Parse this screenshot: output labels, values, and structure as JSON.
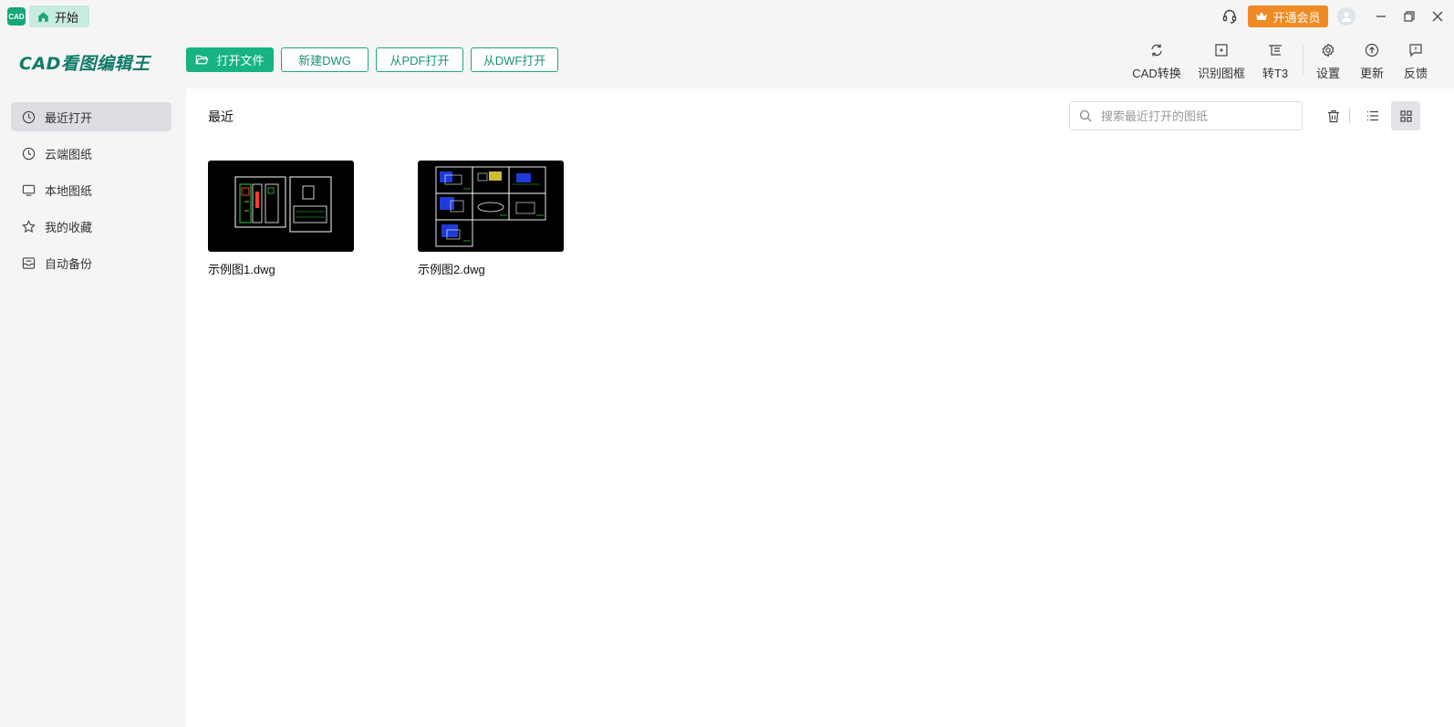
{
  "titlebar": {
    "app_badge": "CAD",
    "home_tab": "开始",
    "vip_button": "开通会员",
    "icons": [
      "headset-icon",
      "crown-icon",
      "avatar-icon",
      "minimize-icon",
      "restore-icon",
      "close-icon"
    ]
  },
  "logo": "CAD看图编辑王",
  "toolbar": {
    "open_file": "打开文件",
    "new_dwg": "新建DWG",
    "open_pdf": "从PDF打开",
    "open_dwf": "从DWF打开"
  },
  "tools": [
    {
      "label": "CAD转换",
      "icon": "convert-icon"
    },
    {
      "label": "识别图框",
      "icon": "frame-detect-icon"
    },
    {
      "label": "转T3",
      "icon": "t3-icon"
    },
    {
      "label": "设置",
      "icon": "gear-icon"
    },
    {
      "label": "更新",
      "icon": "upload-icon"
    },
    {
      "label": "反馈",
      "icon": "feedback-icon"
    }
  ],
  "sidebar": {
    "items": [
      {
        "label": "最近打开",
        "icon": "clock-icon",
        "active": true
      },
      {
        "label": "云端图纸",
        "icon": "clock-icon",
        "active": false
      },
      {
        "label": "本地图纸",
        "icon": "monitor-icon",
        "active": false
      },
      {
        "label": "我的收藏",
        "icon": "star-icon",
        "active": false
      },
      {
        "label": "自动备份",
        "icon": "backup-icon",
        "active": false
      }
    ]
  },
  "main": {
    "title": "最近",
    "search_placeholder": "搜索最近打开的图纸",
    "files": [
      {
        "name": "示例图1.dwg"
      },
      {
        "name": "示例图2.dwg"
      }
    ]
  },
  "colors": {
    "accent": "#17b383",
    "vip": "#f08a24",
    "logo": "#117a68"
  }
}
